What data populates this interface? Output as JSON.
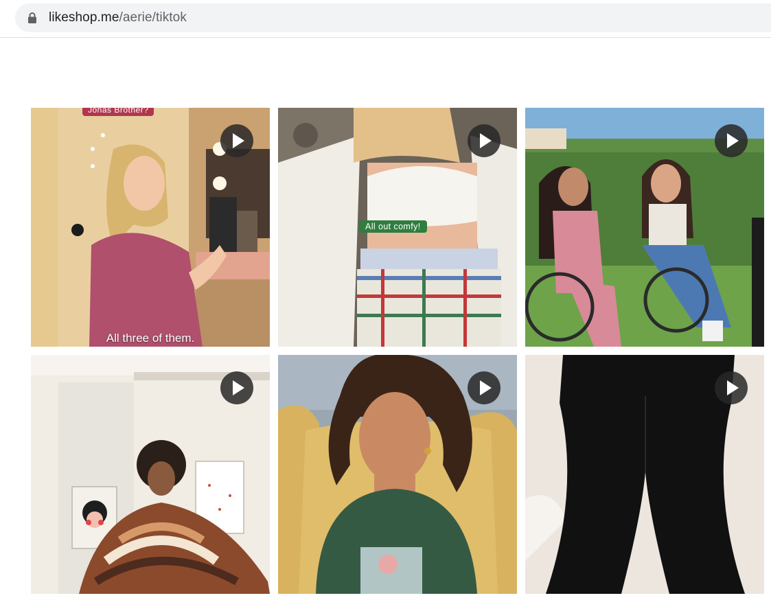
{
  "browser": {
    "url_host": "likeshop.me",
    "url_path": "/aerie/tiktok",
    "icons": {
      "lock": "lock-icon"
    }
  },
  "grid": {
    "tiles": [
      {
        "id": "tile-1",
        "top_caption": "Jonas Brother?",
        "bottom_caption": "All three of them.",
        "has_play": true
      },
      {
        "id": "tile-2",
        "overlay_caption": "All out comfy!",
        "has_play": true
      },
      {
        "id": "tile-3",
        "has_play": true
      },
      {
        "id": "tile-4",
        "has_play": true
      },
      {
        "id": "tile-5",
        "has_play": true
      },
      {
        "id": "tile-6",
        "has_play": true
      }
    ]
  },
  "colors": {
    "caption_pink": "#b0364f",
    "caption_green": "#2f7d3f",
    "play_bg": "#282828"
  }
}
